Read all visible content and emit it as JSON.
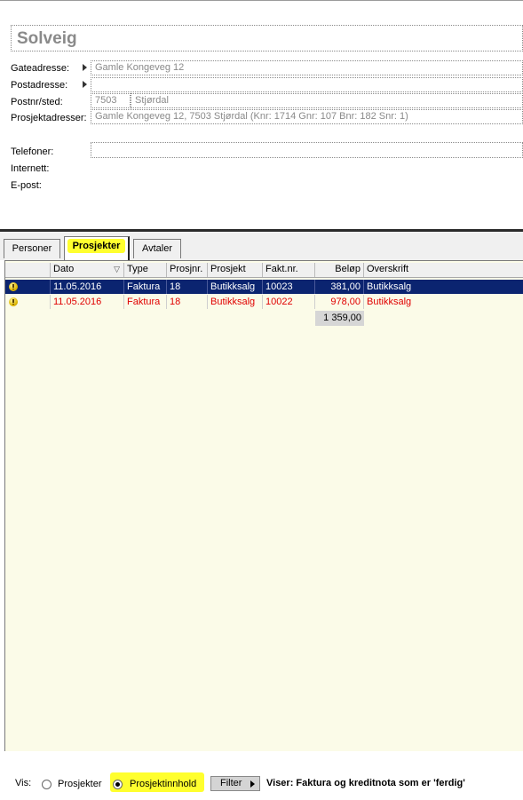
{
  "contact": {
    "name": "Solveig",
    "labels": {
      "gate": "Gateadresse:",
      "post": "Postadresse:",
      "postnr": "Postnr/sted:",
      "prosjektadr": "Prosjektadresser:",
      "telefon": "Telefoner:",
      "internett": "Internett:",
      "epost": "E-post:"
    },
    "gateadresse": "Gamle Kongeveg 12",
    "postadresse": "",
    "postnr": "7503",
    "sted": "Stjørdal",
    "prosjektadresser": "Gamle Kongeveg 12, 7503 Stjørdal (Knr: 1714 Gnr: 107 Bnr: 182 Snr: 1)",
    "telefoner": ""
  },
  "tabs": [
    {
      "label": "Personer"
    },
    {
      "label": "Prosjekter"
    },
    {
      "label": "Avtaler"
    }
  ],
  "grid": {
    "columns": [
      "",
      "Dato",
      "Type",
      "Prosjnr.",
      "Prosjekt",
      "Fakt.nr.",
      "Beløp",
      "Overskrift"
    ],
    "rows": [
      {
        "dato": "11.05.2016",
        "type": "Faktura",
        "prosjnr": "18",
        "prosjekt": "Butikksalg",
        "faktnr": "10023",
        "belop": "381,00",
        "overskrift": "Butikksalg"
      },
      {
        "dato": "11.05.2016",
        "type": "Faktura",
        "prosjnr": "18",
        "prosjekt": "Butikksalg",
        "faktnr": "10022",
        "belop": "978,00",
        "overskrift": "Butikksalg"
      }
    ],
    "total": "1 359,00"
  },
  "footer": {
    "vis_label": "Vis:",
    "radio_prosjekter": "Prosjekter",
    "radio_prosjektinnhold": "Prosjektinnhold",
    "filter_button": "Filter",
    "status": "Viser: Faktura og kreditnota som er 'ferdig'"
  },
  "colors": {
    "selection": "#0b2470",
    "highlight": "#ffff2e",
    "red_text": "#e00000",
    "grid_bg": "#fbfbe8"
  }
}
